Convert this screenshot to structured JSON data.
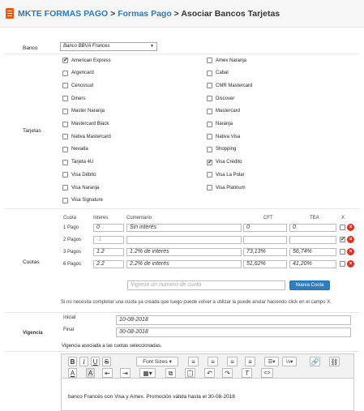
{
  "breadcrumb": {
    "app": "MKTE FORMAS PAGO",
    "sep1": ">",
    "section": "Formas Pago",
    "sep2": ">",
    "current": "Asociar Bancos Tarjetas"
  },
  "banco": {
    "label": "Banco",
    "selected": "Banco BBVA Frances",
    "arrow": "▼"
  },
  "tarjetas": {
    "label": "Tarjetas",
    "left": [
      {
        "name": "American Express",
        "checked": true
      },
      {
        "name": "Argencard",
        "checked": false
      },
      {
        "name": "Cencosud",
        "checked": false
      },
      {
        "name": "Diners",
        "checked": false
      },
      {
        "name": "Master Naranja",
        "checked": false
      },
      {
        "name": "Mastercard Black",
        "checked": false
      },
      {
        "name": "Nativa Mastercard",
        "checked": false
      },
      {
        "name": "Nevada",
        "checked": false
      },
      {
        "name": "Tarjeta 4U",
        "checked": false
      },
      {
        "name": "Visa Débito",
        "checked": false
      },
      {
        "name": "Visa Naranja",
        "checked": false
      },
      {
        "name": "Visa Signature",
        "checked": false
      }
    ],
    "right": [
      {
        "name": "Amex Naranja",
        "checked": false
      },
      {
        "name": "Cabal",
        "checked": false
      },
      {
        "name": "CMR Mastercard",
        "checked": false
      },
      {
        "name": "Discover",
        "checked": false
      },
      {
        "name": "Mastercard",
        "checked": false
      },
      {
        "name": "Naranja",
        "checked": false
      },
      {
        "name": "Nativa Visa",
        "checked": false
      },
      {
        "name": "Shopping",
        "checked": false
      },
      {
        "name": "Visa Crédito",
        "checked": true
      },
      {
        "name": "Visa La Polar",
        "checked": false
      },
      {
        "name": "Visa Platinum",
        "checked": false
      }
    ]
  },
  "cuotas": {
    "label": "Cuotas",
    "headers": {
      "cuota": "Cuota",
      "interes": "Interes",
      "comentario": "Comentario",
      "cft": "CFT",
      "tea": "TEA",
      "x": "X"
    },
    "rows": [
      {
        "label": "1 Pago",
        "interes": "0",
        "comentario": "Sin interés",
        "cft": "0",
        "tea": "0",
        "checked": false
      },
      {
        "label": "2 Pagos",
        "interes": "-1",
        "comentario": "",
        "cft": "",
        "tea": "",
        "checked": true
      },
      {
        "label": "3 Pagos",
        "interes": "1.2",
        "comentario": "1.2% de interés",
        "cft": "73,13%",
        "tea": "56,74%",
        "checked": false
      },
      {
        "label": "6 Pagos",
        "interes": "2.2",
        "comentario": "2.2% de interés",
        "cft": "51,62%",
        "tea": "41,20%",
        "checked": false
      }
    ],
    "new_placeholder": "Ingrese un numero de cuota",
    "new_button": "Nueva Cuota",
    "help": "Si no necesita completar una cuota ya creada que luego puede volver a utilizar la puede anular haciendo click en el campo X."
  },
  "vigencia": {
    "label": "Vigencia",
    "inicial_label": "Inicial",
    "inicial_value": "10-08-2018",
    "final_label": "Final",
    "final_value": "30-08-2018",
    "note": "Vigencia asociada a las cuotas seleccionadas."
  },
  "editor": {
    "font_sizes": "Font Sizes",
    "content": "banco Francés con Visa y Amex. Promoción válida hasta el 30-08-2018"
  }
}
